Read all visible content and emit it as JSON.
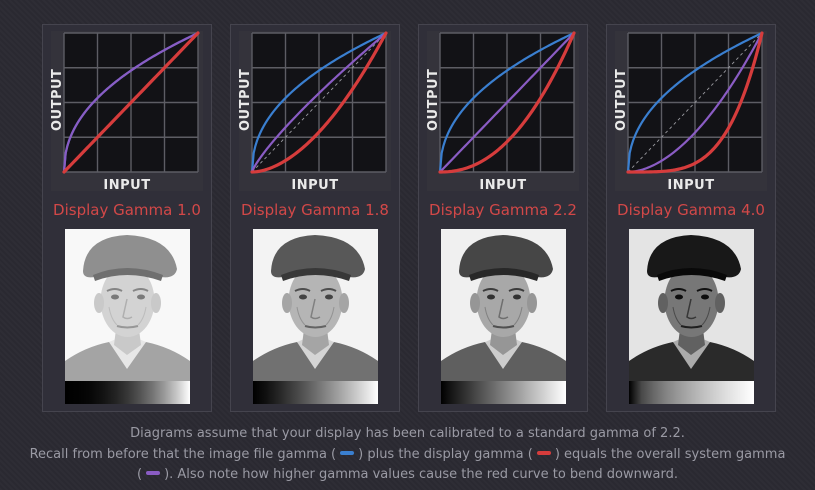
{
  "panels": [
    {
      "title": "Display Gamma 1.0",
      "display_gamma": 1.0,
      "file_gamma": 0.45454545,
      "system_gamma": 0.45454545,
      "photo_gamma": 0.45
    },
    {
      "title": "Display Gamma 1.8",
      "display_gamma": 1.8,
      "file_gamma": 0.45454545,
      "system_gamma": 0.81818182,
      "photo_gamma": 0.82
    },
    {
      "title": "Display Gamma 2.2",
      "display_gamma": 2.2,
      "file_gamma": 0.45454545,
      "system_gamma": 1.0,
      "photo_gamma": 1.0
    },
    {
      "title": "Display Gamma 4.0",
      "display_gamma": 4.0,
      "file_gamma": 0.45454545,
      "system_gamma": 1.81818182,
      "photo_gamma": 1.82
    }
  ],
  "axis": {
    "output_label": "OUTPUT",
    "input_label": "INPUT"
  },
  "colors": {
    "file_gamma": "#3a7fd0",
    "display_gamma": "#d63c3c",
    "system_gamma": "#8a5cc4"
  },
  "caption": {
    "line1": "Diagrams assume that your display has been calibrated to a standard gamma of 2.2.",
    "line2_a": "Recall from before that the image file gamma (",
    "line2_b": ") plus the display gamma (",
    "line2_c": ") equals the overall system gamma",
    "line3_a": "(",
    "line3_b": "). Also note how higher gamma values cause the red curve to bend downward."
  },
  "chart_data": [
    {
      "type": "line",
      "title": "Display Gamma 1.0",
      "xlabel": "INPUT",
      "ylabel": "OUTPUT",
      "xlim": [
        0,
        1
      ],
      "ylim": [
        0,
        1
      ],
      "grid": true,
      "series": [
        {
          "name": "",
          "curve": "power",
          "exponent": 0.45454545,
          "color": "#3a7fd0"
        },
        {
          "name": "",
          "curve": "power",
          "exponent": 1.0,
          "color": "#d63c3c"
        },
        {
          "name": "",
          "curve": "power",
          "exponent": 0.45454545,
          "color": "#8a5cc4"
        }
      ]
    },
    {
      "type": "line",
      "title": "Display Gamma 1.8",
      "xlabel": "INPUT",
      "ylabel": "OUTPUT",
      "xlim": [
        0,
        1
      ],
      "ylim": [
        0,
        1
      ],
      "grid": true,
      "series": [
        {
          "name": "",
          "curve": "power",
          "exponent": 0.45454545,
          "color": "#3a7fd0"
        },
        {
          "name": "",
          "curve": "power",
          "exponent": 1.8,
          "color": "#d63c3c"
        },
        {
          "name": "",
          "curve": "power",
          "exponent": 0.81818182,
          "color": "#8a5cc4"
        }
      ]
    },
    {
      "type": "line",
      "title": "Display Gamma 2.2",
      "xlabel": "INPUT",
      "ylabel": "OUTPUT",
      "xlim": [
        0,
        1
      ],
      "ylim": [
        0,
        1
      ],
      "grid": true,
      "series": [
        {
          "name": "",
          "curve": "power",
          "exponent": 0.45454545,
          "color": "#3a7fd0"
        },
        {
          "name": "",
          "curve": "power",
          "exponent": 2.2,
          "color": "#d63c3c"
        },
        {
          "name": "",
          "curve": "power",
          "exponent": 1.0,
          "color": "#8a5cc4"
        }
      ]
    },
    {
      "type": "line",
      "title": "Display Gamma 4.0",
      "xlabel": "INPUT",
      "ylabel": "OUTPUT",
      "xlim": [
        0,
        1
      ],
      "ylim": [
        0,
        1
      ],
      "grid": true,
      "series": [
        {
          "name": "",
          "curve": "power",
          "exponent": 0.45454545,
          "color": "#3a7fd0"
        },
        {
          "name": "",
          "curve": "power",
          "exponent": 4.0,
          "color": "#d63c3c"
        },
        {
          "name": "",
          "curve": "power",
          "exponent": 1.81818182,
          "color": "#8a5cc4"
        }
      ]
    }
  ]
}
